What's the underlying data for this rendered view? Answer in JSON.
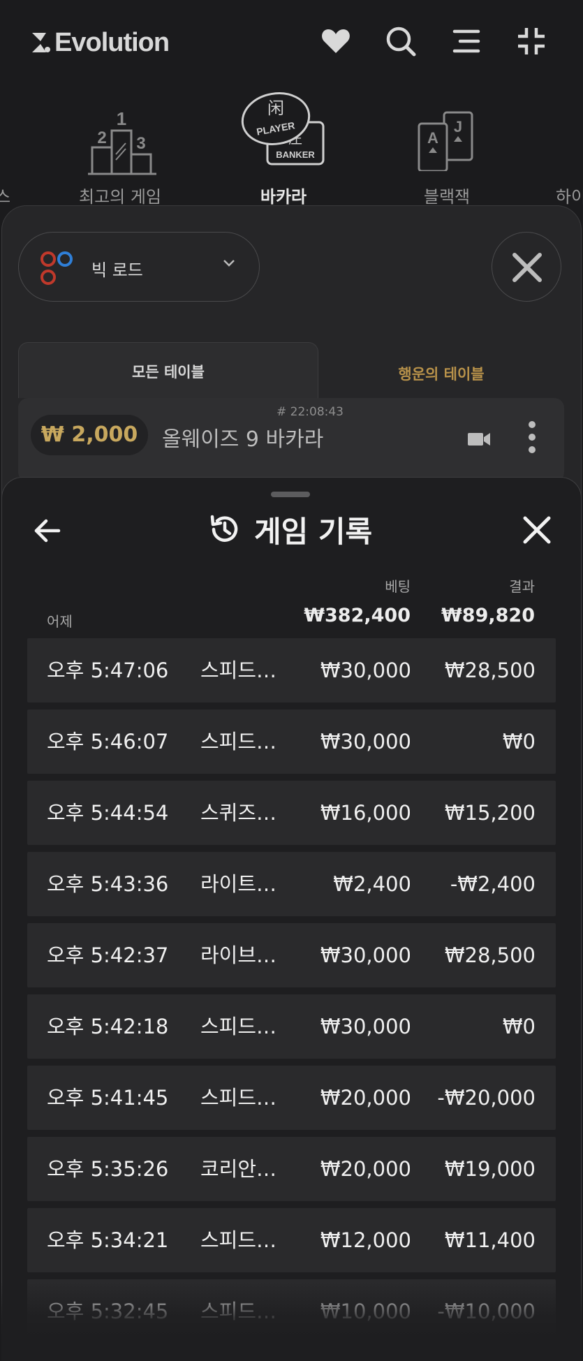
{
  "header": {
    "brand": "Evolution",
    "icons": [
      "heart-icon",
      "search-icon",
      "menu-icon",
      "collapse-icon"
    ]
  },
  "categories": [
    {
      "label": "스",
      "icon": "partial-icon"
    },
    {
      "label": "최고의 게임",
      "icon": "podium-icon"
    },
    {
      "label": "바카라",
      "icon": "baccarat-icon",
      "active": true
    },
    {
      "label": "블랙잭",
      "icon": "cards-icon"
    },
    {
      "label": "하이",
      "icon": "partial-icon"
    }
  ],
  "baccarat_icon_text": {
    "player": "PLAYER",
    "banker": "BANKER",
    "player_hanzi": "闲",
    "banker_hanzi": "庄"
  },
  "podium_numbers": [
    "1",
    "2",
    "3"
  ],
  "card_letters": [
    "A",
    "J"
  ],
  "road_selector": {
    "label": "빅 로드"
  },
  "tabs": {
    "all": "모든 테이블",
    "lucky": "행운의 테이블"
  },
  "table_card": {
    "time": "# 22:08:43",
    "min_bet": "₩ 2,000",
    "name": "올웨이즈 9 바카라"
  },
  "history": {
    "title": "게임 기록",
    "col_bet": "베팅",
    "col_result": "결과",
    "day_label": "어제",
    "total_bet": "₩382,400",
    "total_result": "₩89,820",
    "rows": [
      {
        "time": "오후 5:47:06",
        "game": "스피드…",
        "bet": "₩30,000",
        "result": "₩28,500"
      },
      {
        "time": "오후 5:46:07",
        "game": "스피드…",
        "bet": "₩30,000",
        "result": "₩0"
      },
      {
        "time": "오후 5:44:54",
        "game": "스퀴즈…",
        "bet": "₩16,000",
        "result": "₩15,200"
      },
      {
        "time": "오후 5:43:36",
        "game": "라이트…",
        "bet": "₩2,400",
        "result": "-₩2,400"
      },
      {
        "time": "오후 5:42:37",
        "game": "라이브…",
        "bet": "₩30,000",
        "result": "₩28,500"
      },
      {
        "time": "오후 5:42:18",
        "game": "스피드…",
        "bet": "₩30,000",
        "result": "₩0"
      },
      {
        "time": "오후 5:41:45",
        "game": "스피드…",
        "bet": "₩20,000",
        "result": "-₩20,000"
      },
      {
        "time": "오후 5:35:26",
        "game": "코리안…",
        "bet": "₩20,000",
        "result": "₩19,000"
      },
      {
        "time": "오후 5:34:21",
        "game": "스피드…",
        "bet": "₩12,000",
        "result": "₩11,400"
      },
      {
        "time": "오후 5:32:45",
        "game": "스피드…",
        "bet": "₩10,000",
        "result": "-₩10,000"
      }
    ]
  },
  "colors": {
    "accent_gold": "#c8a85e",
    "lucky_tab": "#b8924a",
    "road_red": "#c0392b",
    "road_blue": "#2f7fd8"
  }
}
